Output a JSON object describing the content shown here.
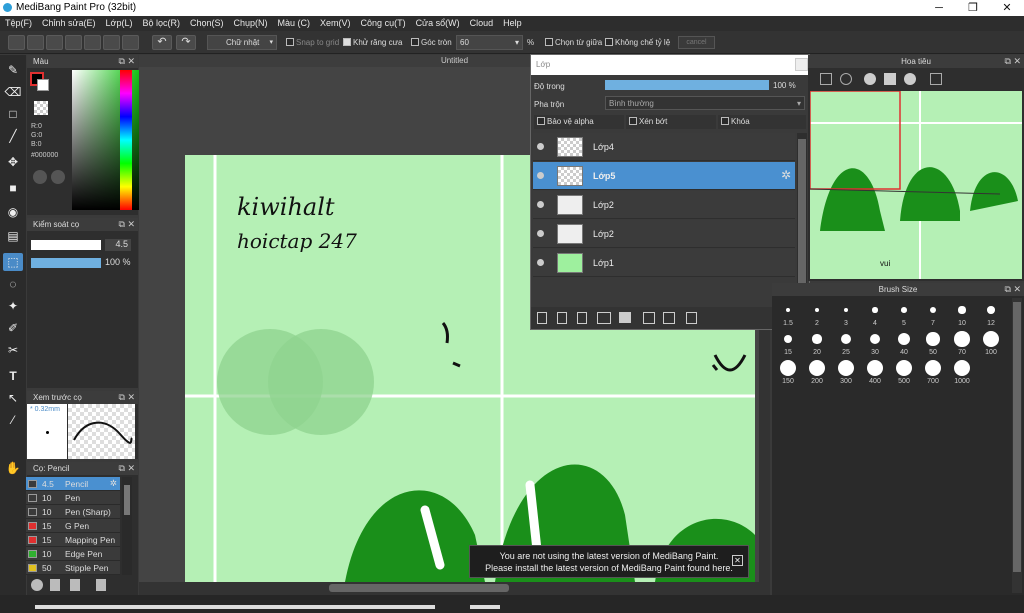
{
  "app": {
    "title": "MediBang Paint Pro (32bit)"
  },
  "menu": [
    "Tệp(F)",
    "Chỉnh sửa(E)",
    "Lớp(L)",
    "Bộ lọc(R)",
    "Chọn(S)",
    "Chụp(N)",
    "Màu (C)",
    "Xem(V)",
    "Công cụ(T)",
    "Cửa sổ(W)",
    "Cloud",
    "Help"
  ],
  "toolbar": {
    "selection_shape": "Chữ nhật",
    "snap_to_grid": "Snap to grid",
    "antialias": "Khử răng cưa",
    "round_corner": "Góc tròn",
    "round_value": "60",
    "percent": "%",
    "select_center": "Chọn từ giữa",
    "no_ratio": "Không chế tỷ lệ",
    "cancel_label": "cancel"
  },
  "color_panel": {
    "title": "Màu",
    "r": "R:0",
    "g": "G:0",
    "b": "B:0",
    "hex": "#000000",
    "primary": "#000000",
    "secondary": "#ffffff"
  },
  "brush_control": {
    "title": "Kiểm soát cọ",
    "size": "4.5",
    "opacity": "100 %"
  },
  "brush_preview": {
    "title": "Xem trước cọ",
    "size_label": "* 0.32mm"
  },
  "brush_list": {
    "title": "Cọ: Pencil",
    "items": [
      {
        "size": "4.5",
        "name": "Pencil",
        "color": "#3a3a3a"
      },
      {
        "size": "10",
        "name": "Pen",
        "color": "#3a3a3a"
      },
      {
        "size": "10",
        "name": "Pen (Sharp)",
        "color": "#3a3a3a"
      },
      {
        "size": "15",
        "name": "G Pen",
        "color": "#e03030"
      },
      {
        "size": "15",
        "name": "Mapping Pen",
        "color": "#e03030"
      },
      {
        "size": "10",
        "name": "Edge Pen",
        "color": "#30b030"
      },
      {
        "size": "50",
        "name": "Stipple Pen",
        "color": "#e0c020"
      }
    ]
  },
  "canvas": {
    "title": "Untitled",
    "art_text_1": "kiwihalt",
    "art_text_2": "hoictap 247"
  },
  "layers": {
    "title": "Lớp",
    "opacity_label": "Độ trong",
    "opacity_value": "100 %",
    "blend_label": "Pha trộn",
    "blend_value": "Bình thường",
    "protect_alpha": "Bảo vệ alpha",
    "clipping": "Xén bớt",
    "lock": "Khóa",
    "items": [
      {
        "name": "Lớp4"
      },
      {
        "name": "Lớp5"
      },
      {
        "name": "Lớp2"
      },
      {
        "name": "Lớp2"
      },
      {
        "name": "Lớp1"
      }
    ]
  },
  "navigator": {
    "title": "Hoa tiêu",
    "thumb_text": "vui"
  },
  "brush_size": {
    "title": "Brush Size",
    "sizes": [
      "1.5",
      "2",
      "3",
      "4",
      "5",
      "7",
      "10",
      "12",
      "15",
      "20",
      "25",
      "30",
      "40",
      "50",
      "70",
      "100",
      "150",
      "200",
      "300",
      "400",
      "500",
      "700",
      "1000"
    ]
  },
  "notice": {
    "line1": "You are not using the latest version of MediBang Paint.",
    "line2": "Please install the latest version of MediBang Paint found here."
  }
}
